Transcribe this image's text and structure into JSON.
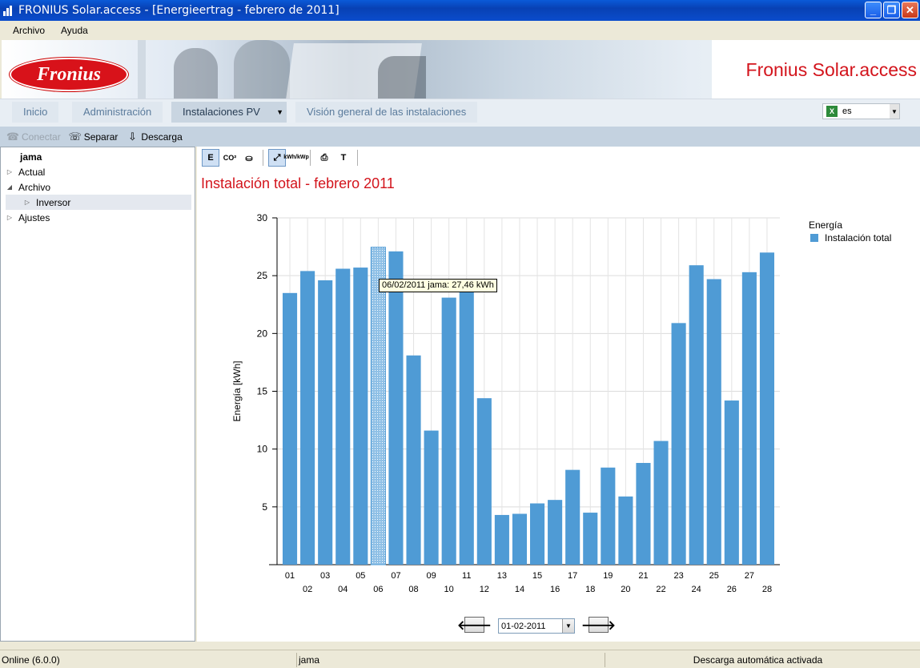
{
  "window": {
    "title": "FRONIUS Solar.access - [Energieertrag - febrero de 2011]",
    "buttons": {
      "minimize": "_",
      "maximize": "❐",
      "close": "✕"
    }
  },
  "menu": {
    "items": [
      "Archivo",
      "Ayuda"
    ]
  },
  "banner": {
    "logo_text": "Fronius",
    "brand": "Fronius Solar.access"
  },
  "nav": {
    "tabs": [
      "Inicio",
      "Administración",
      "Instalaciones PV",
      "Visión general de las instalaciones"
    ],
    "active_tab": "Instalaciones PV",
    "language": "es"
  },
  "toolbar": {
    "connect": "Conectar",
    "disconnect": "Separar",
    "download": "Descarga"
  },
  "tree": {
    "root": "jama",
    "items": [
      {
        "label": "Actual",
        "expand": "▷"
      },
      {
        "label": "Archivo",
        "expand": "◢"
      },
      {
        "label": "Inversor",
        "expand": "▷"
      },
      {
        "label": "Ajustes",
        "expand": "▷"
      }
    ]
  },
  "chart_toolbar": {
    "energy": "E",
    "co2": "CO²",
    "kwh_kwp": "kWh/kWp",
    "text": "T"
  },
  "chart_title": "Instalación total - febrero 2011",
  "chart_data": {
    "type": "bar",
    "ylabel": "Energía [kWh]",
    "ylim": [
      0,
      30
    ],
    "yticks": [
      5,
      10,
      15,
      20,
      25,
      30
    ],
    "grid": true,
    "categories": [
      "01",
      "02",
      "03",
      "04",
      "05",
      "06",
      "07",
      "08",
      "09",
      "10",
      "11",
      "12",
      "13",
      "14",
      "15",
      "16",
      "17",
      "18",
      "19",
      "20",
      "21",
      "22",
      "23",
      "24",
      "25",
      "26",
      "27",
      "28"
    ],
    "series": [
      {
        "name": "Instalación total",
        "color": "#4f9bd5",
        "values": [
          23.5,
          25.4,
          24.6,
          25.6,
          25.7,
          27.46,
          27.1,
          18.1,
          11.6,
          23.1,
          24.0,
          14.4,
          4.3,
          4.4,
          5.3,
          5.6,
          8.2,
          4.5,
          8.4,
          5.9,
          8.8,
          10.7,
          20.9,
          25.9,
          24.7,
          14.2,
          25.3,
          27.0
        ]
      }
    ],
    "legend_title": "Energía",
    "legend_placement": "top-right",
    "highlighted_index": 5
  },
  "tooltip": "06/02/2011 jama: 27,46 kWh",
  "date_select": {
    "value": "01-02-2011",
    "prev": "🡐",
    "next": "🡒"
  },
  "status": {
    "online": "Online (6.0.0)",
    "user": "jama",
    "download": "Descarga automática activada"
  }
}
